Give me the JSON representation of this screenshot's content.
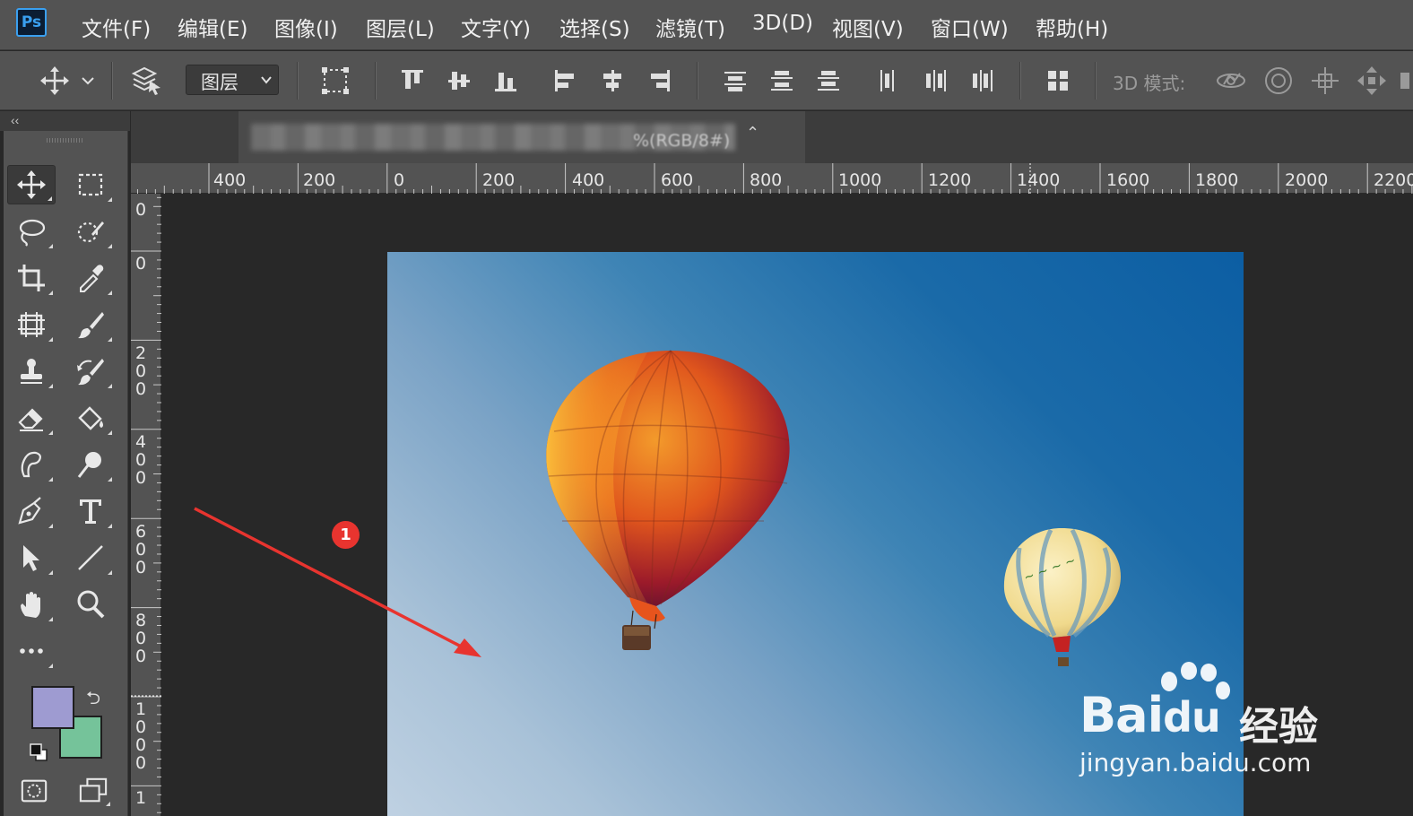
{
  "app": {
    "logo": "Ps"
  },
  "menu": [
    {
      "id": "file",
      "label": "文件(F)"
    },
    {
      "id": "edit",
      "label": "编辑(E)"
    },
    {
      "id": "image",
      "label": "图像(I)"
    },
    {
      "id": "layer",
      "label": "图层(L)"
    },
    {
      "id": "type",
      "label": "文字(Y)"
    },
    {
      "id": "select",
      "label": "选择(S)"
    },
    {
      "id": "filter",
      "label": "滤镜(T)"
    },
    {
      "id": "3d",
      "label": "3D(D)"
    },
    {
      "id": "view",
      "label": "视图(V)"
    },
    {
      "id": "window",
      "label": "窗口(W)"
    },
    {
      "id": "help",
      "label": "帮助(H)"
    }
  ],
  "options_bar": {
    "auto_select_target": "图层",
    "mode_3d_label": "3D 模式:",
    "icons": [
      "move-icon",
      "auto-select-layers-icon",
      "transform-controls-icon",
      "align-top-icon",
      "align-vertical-center-icon",
      "align-bottom-icon",
      "align-left-icon",
      "align-horizontal-center-icon",
      "align-right-icon",
      "distribute-top-icon",
      "distribute-vertical-center-icon",
      "distribute-bottom-icon",
      "distribute-left-icon",
      "distribute-horizontal-center-icon",
      "distribute-right-icon",
      "auto-align-icon",
      "3d-orbit-icon",
      "3d-roll-icon",
      "3d-pan-icon",
      "3d-slide-icon"
    ]
  },
  "document": {
    "tab_title_visible": "%(RGB/8#)"
  },
  "ruler": {
    "horizontal_labels": [
      "400",
      "200",
      "0",
      "200",
      "400",
      "600",
      "800",
      "1000",
      "1200",
      "1400",
      "1600",
      "1800",
      "2000",
      "2200"
    ],
    "vertical_labels": [
      "0",
      "0",
      "200",
      "400",
      "600",
      "800",
      "1000",
      "1"
    ]
  },
  "tools": [
    {
      "name": "move-tool",
      "icon": "move-icon",
      "active": true
    },
    {
      "name": "marquee-tool",
      "icon": "rectangle-marquee-icon"
    },
    {
      "name": "lasso-tool",
      "icon": "lasso-icon"
    },
    {
      "name": "quick-selection-tool",
      "icon": "quick-selection-icon"
    },
    {
      "name": "crop-tool",
      "icon": "crop-icon"
    },
    {
      "name": "eyedropper-tool",
      "icon": "eyedropper-icon"
    },
    {
      "name": "spot-healing-tool",
      "icon": "healing-brush-icon"
    },
    {
      "name": "brush-tool",
      "icon": "brush-icon"
    },
    {
      "name": "clone-stamp-tool",
      "icon": "stamp-icon"
    },
    {
      "name": "history-brush-tool",
      "icon": "history-brush-icon"
    },
    {
      "name": "eraser-tool",
      "icon": "eraser-icon"
    },
    {
      "name": "paint-bucket-tool",
      "icon": "paint-bucket-icon"
    },
    {
      "name": "smudge-tool",
      "icon": "smudge-icon"
    },
    {
      "name": "dodge-tool",
      "icon": "dodge-icon"
    },
    {
      "name": "pen-tool",
      "icon": "pen-icon"
    },
    {
      "name": "type-tool",
      "icon": "type-icon"
    },
    {
      "name": "path-selection-tool",
      "icon": "arrow-pointer-icon"
    },
    {
      "name": "line-tool",
      "icon": "line-icon"
    },
    {
      "name": "hand-tool",
      "icon": "hand-icon"
    },
    {
      "name": "zoom-tool",
      "icon": "magnifier-icon"
    },
    {
      "name": "edit-toolbar",
      "icon": "more-dots-icon"
    }
  ],
  "colors": {
    "foreground": "#9e9bd1",
    "background": "#75c39a",
    "accent": "#3aa0f0",
    "annotation": "#e8342f"
  },
  "annotation": {
    "step_number": "1"
  },
  "watermark": {
    "brand": "Bai",
    "brand_paw": "du",
    "brand_cn": "经验",
    "url": "jingyan.baidu.com"
  }
}
